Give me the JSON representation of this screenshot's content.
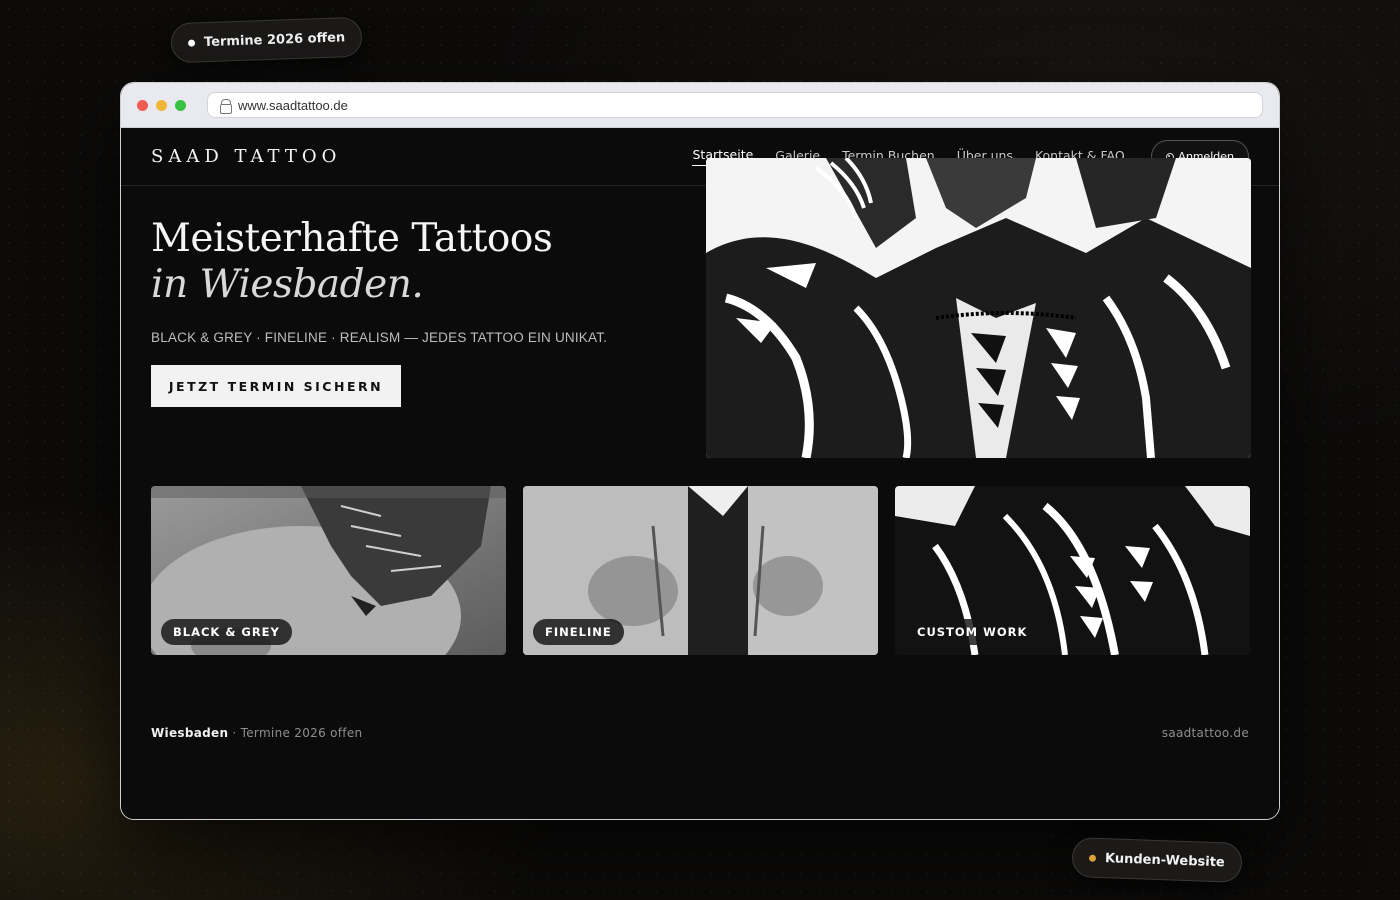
{
  "badges": {
    "top": "Termine 2026 offen",
    "bottom": "Kunden-Website"
  },
  "browser": {
    "url": "www.saadtattoo.de"
  },
  "site": {
    "brand": "SAAD TATTOO",
    "nav": [
      "Startseite",
      "Galerie",
      "Termin Buchen",
      "Über uns",
      "Kontakt & FAQ"
    ],
    "login": "Anmelden",
    "hero": {
      "title_line1": "Meisterhafte Tattoos",
      "title_line2": "in Wiesbaden.",
      "tagline": "BLACK & GREY · FINELINE · REALISM — JEDES TATTOO EIN UNIKAT.",
      "cta": "JETZT TERMIN SICHERN"
    },
    "cards": [
      {
        "label": "BLACK & GREY"
      },
      {
        "label": "FINELINE"
      },
      {
        "label": "CUSTOM WORK"
      }
    ],
    "footer": {
      "city": "Wiesbaden",
      "status": "· Termine 2026 offen",
      "domain": "saadtattoo.de"
    }
  },
  "colors": {
    "page_bg": "#0c0b0a",
    "site_bg": "#0b0b0b",
    "accent_dot": "#d9a23a",
    "cta_bg": "#f2f2f2"
  }
}
